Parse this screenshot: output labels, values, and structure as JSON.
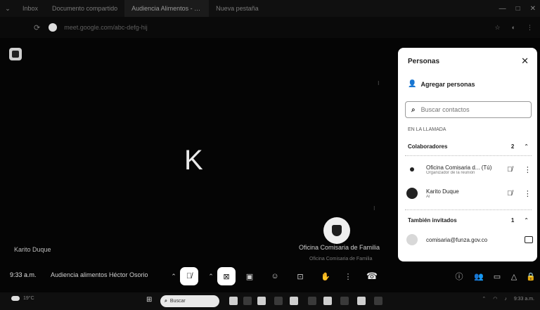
{
  "browser": {
    "tabs": [
      {
        "label": "Inbox",
        "active": false
      },
      {
        "label": "Documento compartido",
        "active": false
      },
      {
        "label": "Audiencia Alimentos - Meet",
        "active": true
      },
      {
        "label": "Nueva pestaña",
        "active": false
      }
    ],
    "url": "meet.google.com/abc-defg-hij"
  },
  "stage": {
    "main_initial": "K",
    "self_name": "Karito Duque",
    "tile_name": "Oficina Comisaria de Familia",
    "tile_sub": "Oficina Comisaria de Familia"
  },
  "panel": {
    "title": "Personas",
    "add_label": "Agregar personas",
    "search_placeholder": "Buscar contactos",
    "section_label": "EN LA LLAMADA",
    "groups": [
      {
        "label": "Colaboradores",
        "count": "2"
      },
      {
        "label": "También invitados",
        "count": "1"
      }
    ],
    "people": [
      {
        "name": "Oficina Comisaria d... (Tú)",
        "sub": "Organizador de la reunión"
      },
      {
        "name": "Karito Duque",
        "sub": "Al"
      },
      {
        "name": "comisaria@funza.gov.co"
      }
    ]
  },
  "controls": {
    "time": "9:33 a.m.",
    "meeting_title": "Audiencia alimentos Héctor Osorio"
  },
  "taskbar": {
    "weather_temp": "19°C",
    "search_placeholder": "Buscar",
    "clock": "9:33 a.m."
  }
}
